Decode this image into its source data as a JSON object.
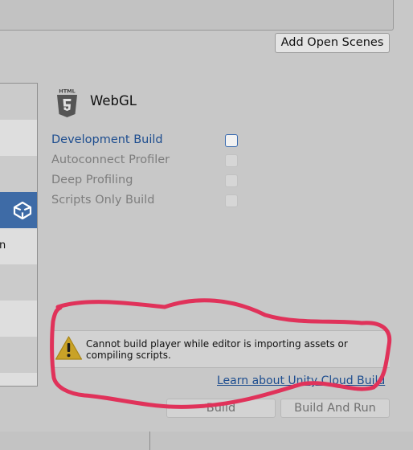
{
  "scenes": {
    "add_open_scenes_label": "Add Open Scenes"
  },
  "platform_list": {
    "selected_icon": "unity-icon",
    "cut_off_text": "n"
  },
  "platform": {
    "icon": "html5-icon",
    "title": "WebGL"
  },
  "options": [
    {
      "label": "Development Build",
      "checked": false,
      "enabled": true
    },
    {
      "label": "Autoconnect Profiler",
      "checked": false,
      "enabled": false
    },
    {
      "label": "Deep Profiling",
      "checked": false,
      "enabled": false
    },
    {
      "label": "Scripts Only Build",
      "checked": false,
      "enabled": false
    }
  ],
  "help": {
    "icon": "warning-icon",
    "message": "Cannot build player while editor is importing assets or compiling scripts."
  },
  "cloud_link": "Learn about Unity Cloud Build",
  "buttons": {
    "build": "Build",
    "build_and_run": "Build And Run"
  },
  "colors": {
    "background": "#c8c8c8",
    "selected_row": "#3e6ba6",
    "link": "#1d4d8f",
    "annotation": "#e0325a",
    "warning": "#c9a227"
  }
}
